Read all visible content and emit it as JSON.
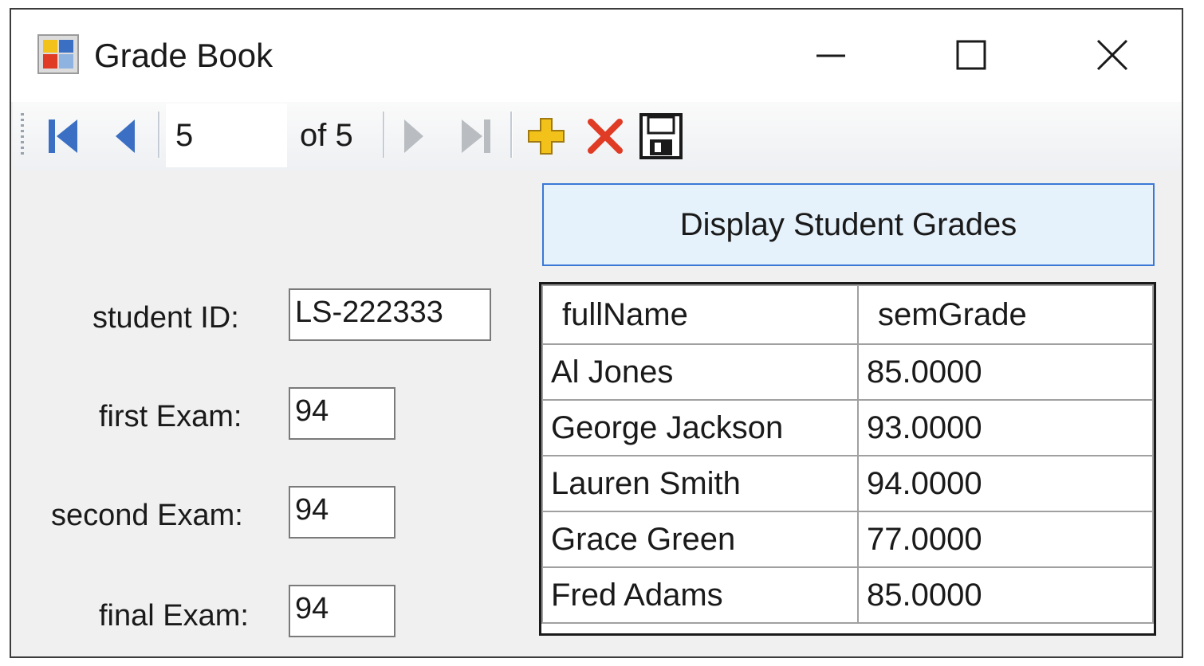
{
  "window": {
    "title": "Grade Book"
  },
  "navigator": {
    "position": "5",
    "count_label": "of 5"
  },
  "form": {
    "student_id_label": "student ID:",
    "student_id_value": "LS-222333",
    "first_exam_label": "first Exam:",
    "first_exam_value": "94",
    "second_exam_label": "second Exam:",
    "second_exam_value": "94",
    "final_exam_label": "final Exam:",
    "final_exam_value": "94"
  },
  "display_button": {
    "label": "Display Student Grades"
  },
  "grid": {
    "columns": [
      "fullName",
      "semGrade"
    ],
    "rows": [
      [
        "Al Jones",
        "85.0000"
      ],
      [
        "George Jackson",
        "93.0000"
      ],
      [
        "Lauren Smith",
        "94.0000"
      ],
      [
        "Grace Green",
        "77.0000"
      ],
      [
        "Fred Adams",
        "85.0000"
      ]
    ]
  },
  "colors": {
    "accent_border": "#3b78d6",
    "button_fill": "#e5f1fb",
    "nav_blue": "#3a6fc4",
    "delete_red": "#e03b24",
    "add_yellow": "#f2c21a"
  },
  "icons": [
    "app-icon",
    "minimize-icon",
    "maximize-icon",
    "close-icon",
    "move-first-icon",
    "move-previous-icon",
    "move-next-icon",
    "move-last-icon",
    "add-new-icon",
    "delete-icon",
    "save-icon"
  ]
}
